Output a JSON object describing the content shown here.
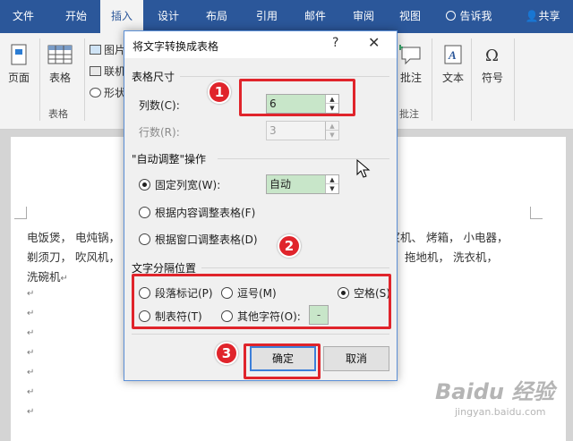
{
  "ribbon": {
    "tabs": [
      "文件",
      "开始",
      "插入",
      "设计",
      "布局",
      "引用",
      "邮件",
      "审阅",
      "视图"
    ],
    "active_tab": "插入",
    "tell_me": "告诉我",
    "share": "共享",
    "buttons": {
      "pages": "页面",
      "table": "表格",
      "picture": "图片",
      "online_picture": "联机",
      "shapes": "形状",
      "comment": "批注",
      "text": "文本",
      "symbols": "符号"
    },
    "groups": {
      "tables": "表格",
      "comments": "批注"
    }
  },
  "document": {
    "line1_left": "电饭煲，  电炖锅，",
    "line1_right": "豆浆机、  烤箱，  小电器，",
    "line2_left": "剃须刀，  吹风机，",
    "line2_right": "拖地机，  洗衣机，",
    "line3": "洗碗机",
    "para_mark": "↵"
  },
  "dialog": {
    "title": "将文字转换成表格",
    "help": "?",
    "close": "✕",
    "size_section": "表格尺寸",
    "columns_label": "列数(C):",
    "columns_value": "6",
    "rows_label": "行数(R):",
    "rows_value": "3",
    "autofit_section": "\"自动调整\"操作",
    "fixed_width_label": "固定列宽(W):",
    "fixed_width_value": "自动",
    "fit_contents_label": "根据内容调整表格(F)",
    "fit_window_label": "根据窗口调整表格(D)",
    "separator_section": "文字分隔位置",
    "sep_paragraph": "段落标记(P)",
    "sep_comma": "逗号(M)",
    "sep_space": "空格(S)",
    "sep_tab": "制表符(T)",
    "sep_other": "其他字符(O):",
    "sep_other_value": "-",
    "ok": "确定",
    "cancel": "取消"
  },
  "callouts": [
    "1",
    "2",
    "3"
  ],
  "watermark": {
    "main": "Baidu 经验",
    "sub": "jingyan.baidu.com"
  }
}
